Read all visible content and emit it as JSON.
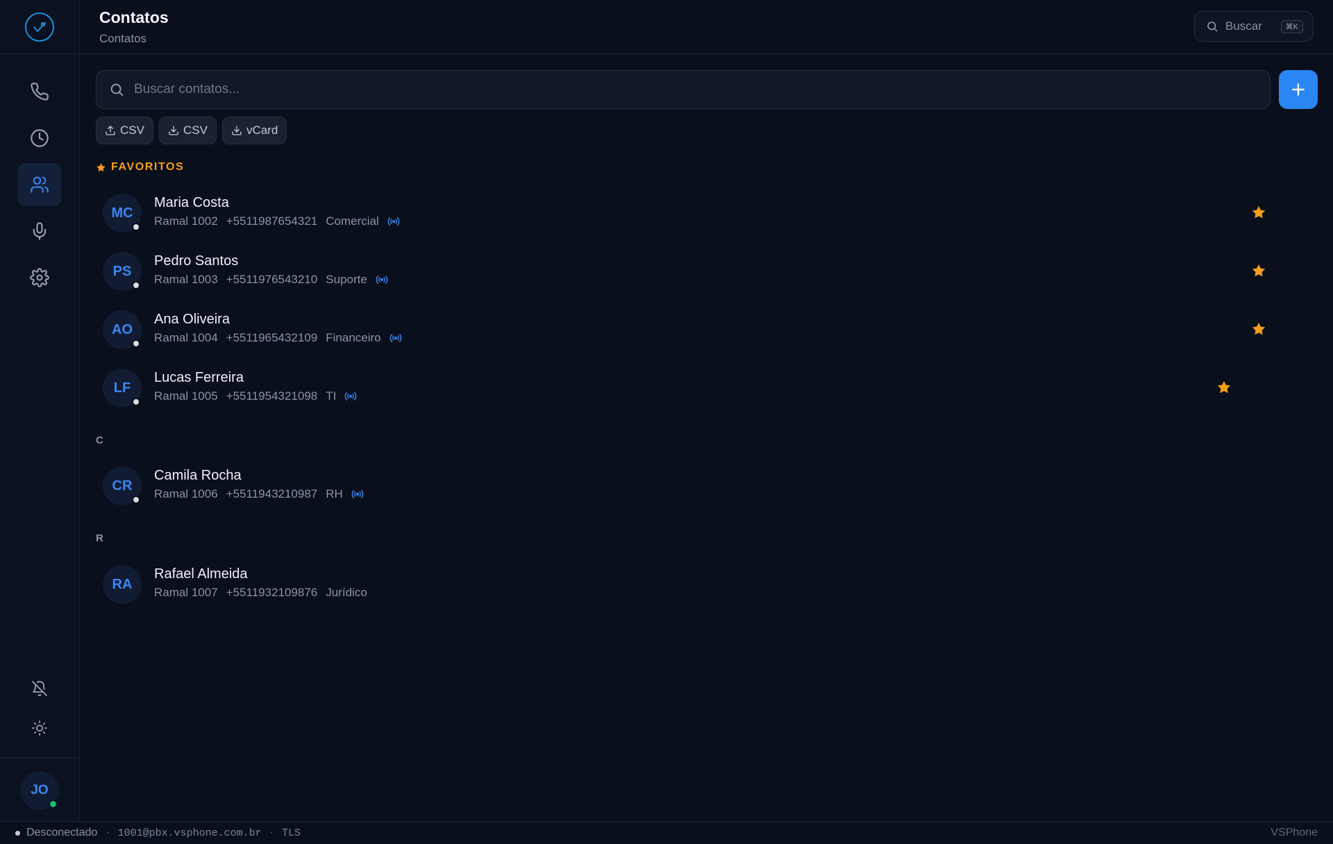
{
  "header": {
    "title": "Contatos",
    "subtitle": "Contatos",
    "search_label": "Buscar",
    "search_shortcut": "⌘K"
  },
  "search": {
    "placeholder": "Buscar contatos..."
  },
  "actions": {
    "import_csv": "CSV",
    "export_csv": "CSV",
    "export_vcard": "vCard"
  },
  "sections": {
    "favorites": "FAVORITOS",
    "c": "C",
    "r": "R"
  },
  "contacts": [
    {
      "initials": "MC",
      "name": "Maria Costa",
      "extension": "Ramal 1002",
      "phone": "+5511987654321",
      "department": "Comercial",
      "favorite": true
    },
    {
      "initials": "PS",
      "name": "Pedro Santos",
      "extension": "Ramal 1003",
      "phone": "+5511976543210",
      "department": "Suporte",
      "favorite": true
    },
    {
      "initials": "AO",
      "name": "Ana Oliveira",
      "extension": "Ramal 1004",
      "phone": "+5511965432109",
      "department": "Financeiro",
      "favorite": true
    },
    {
      "initials": "LF",
      "name": "Lucas Ferreira",
      "extension": "Ramal 1005",
      "phone": "+5511954321098",
      "department": "TI",
      "favorite": true
    },
    {
      "initials": "CR",
      "name": "Camila Rocha",
      "extension": "Ramal 1006",
      "phone": "+5511943210987",
      "department": "RH",
      "favorite": false
    },
    {
      "initials": "RA",
      "name": "Rafael Almeida",
      "extension": "Ramal 1007",
      "phone": "+5511932109876",
      "department": "Jurídico",
      "favorite": false
    }
  ],
  "user": {
    "initials": "JO",
    "status_color": "#1fbf6a"
  },
  "footer": {
    "status": "Desconectado",
    "account": "1001@pbx.vsphone.com.br",
    "transport": "TLS",
    "brand": "VSPhone"
  },
  "colors": {
    "accent": "#2a86f2",
    "favorite": "#f59e1b",
    "background": "#0a0f1c"
  },
  "icons": {
    "nav": [
      "phone-icon",
      "clock-icon",
      "users-icon",
      "microphone-icon",
      "gear-icon"
    ],
    "bottom": [
      "bell-off-icon",
      "sun-icon"
    ]
  }
}
